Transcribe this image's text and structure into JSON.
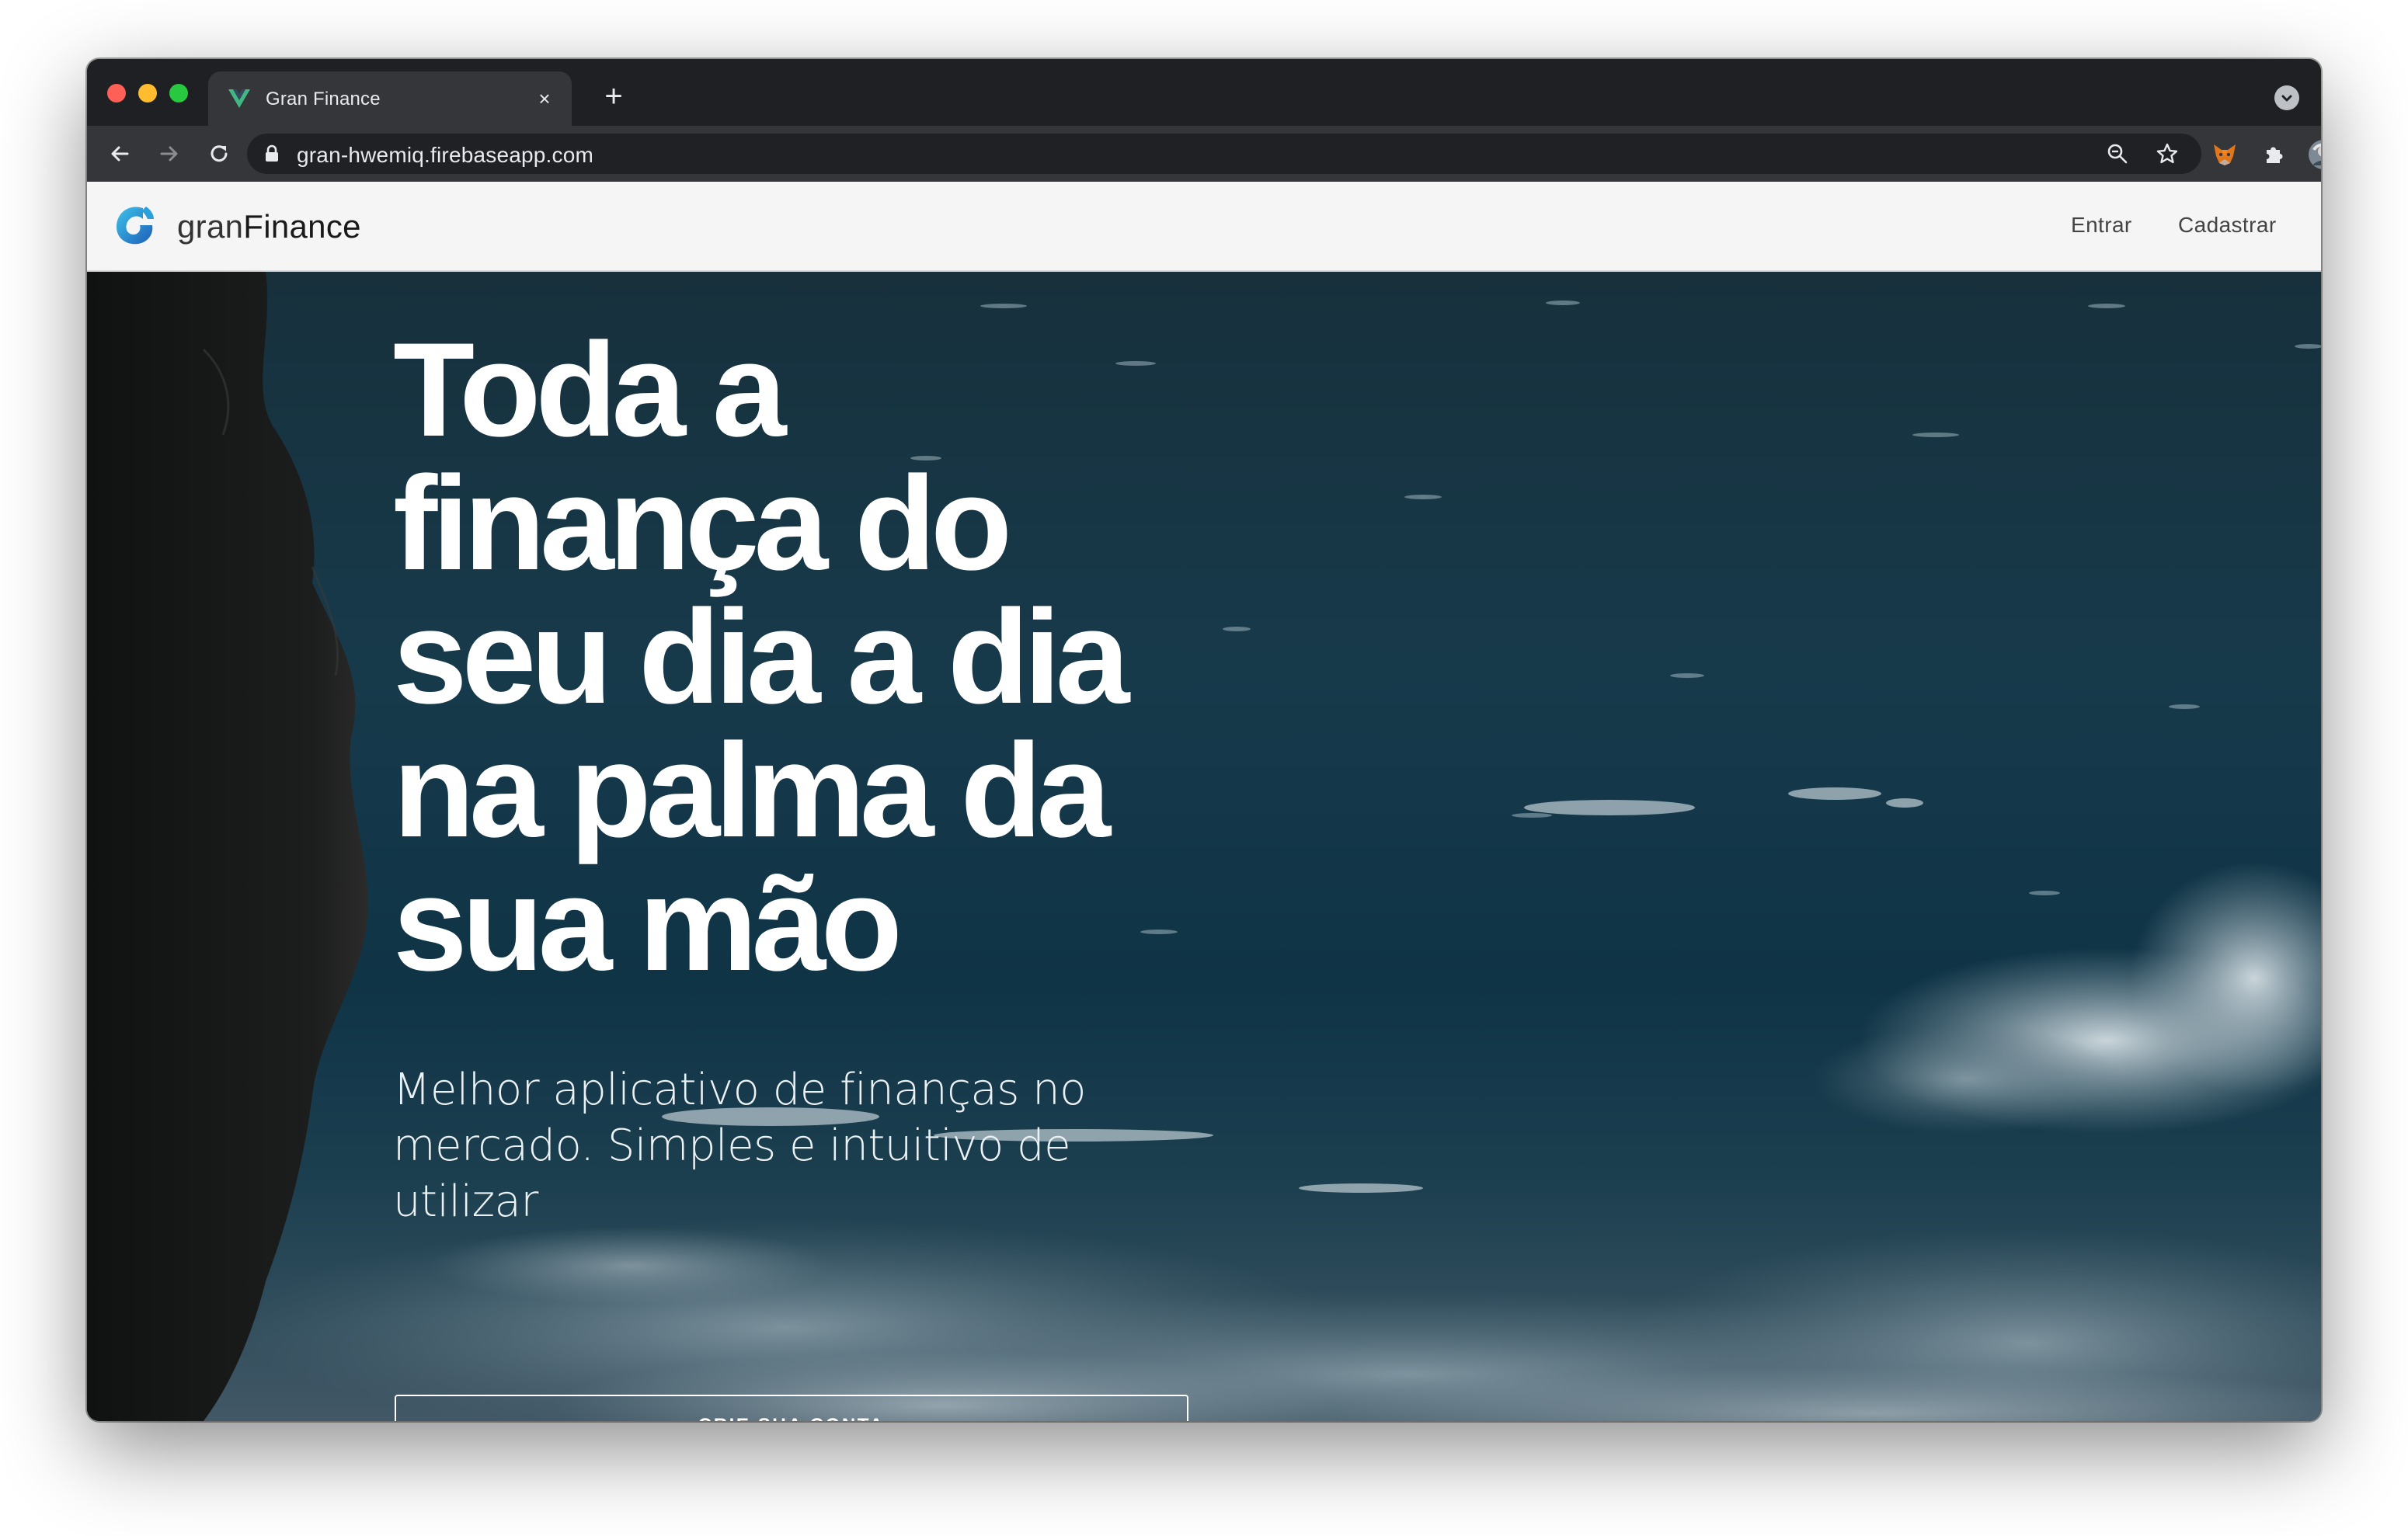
{
  "browser": {
    "tab_title": "Gran Finance",
    "tab_close": "×",
    "new_tab": "+",
    "url": "gran-hwemiq.firebaseapp.com"
  },
  "appbar": {
    "logo_light": "gran",
    "logo_bold": "Finance",
    "nav": [
      {
        "label": "Entrar"
      },
      {
        "label": "Cadastrar"
      }
    ]
  },
  "hero": {
    "headline_lines": [
      "Toda a",
      "finança do",
      "seu dia a dia",
      "na palma da",
      "sua mão"
    ],
    "subtitle": "Melhor aplicativo de finanças no mercado. Simples e intuitivo de utilizar",
    "cta_label": "CRIE SUA CONTA"
  },
  "colors": {
    "chrome_dark": "#202124",
    "tab_active": "#35363a",
    "appbar_bg": "#f5f5f5",
    "sea_dark": "#0f3041",
    "logo_blue": "#1f8fd6"
  },
  "icons": {
    "tab_favicon": "vue-logo-icon",
    "back": "arrow-left-icon",
    "forward": "arrow-right-icon",
    "reload": "reload-icon",
    "lock": "lock-icon",
    "zoom": "zoom-icon",
    "bookmark": "star-icon",
    "extension_fox": "fox-extension-icon",
    "extensions": "puzzle-icon",
    "profile": "avatar",
    "menu": "kebab-menu-icon",
    "tab_search": "chevron-down-icon",
    "app_logo": "granfinance-logo-icon"
  }
}
